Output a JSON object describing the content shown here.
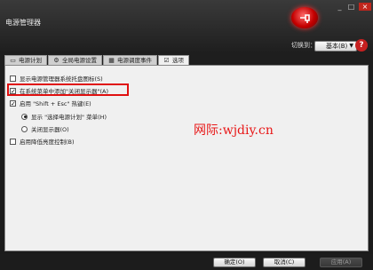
{
  "window": {
    "title": "电源管理器"
  },
  "controls": {
    "minimize": "_",
    "maximize": "□",
    "close": "×"
  },
  "switch": {
    "label": "切换到：",
    "value": "基本(B)"
  },
  "help": {
    "label": "?"
  },
  "tabs": [
    {
      "label": "电源计划",
      "icon": "battery-icon"
    },
    {
      "label": "全局电源设置",
      "icon": "gear-icon"
    },
    {
      "label": "电源调度事件",
      "icon": "calendar-icon"
    },
    {
      "label": "选项",
      "icon": "checkbox-icon"
    }
  ],
  "options": {
    "tray_icon": {
      "label": "显示电源管理器系统托盘图标(S)",
      "checked": false
    },
    "system_menu": {
      "label": "在系统菜单中添加\"关闭显示器\"(A)",
      "checked": true
    },
    "hotkey": {
      "label": "启用 \"Shift + Esc\" 热键(E)",
      "checked": true
    },
    "radio_menu": {
      "label": "显示 \"选择电源计划\" 菜单(H)",
      "selected": true
    },
    "radio_display": {
      "label": "关闭显示器(O)",
      "selected": false
    },
    "brightness": {
      "label": "启用降低亮度控制(B)",
      "checked": false
    }
  },
  "watermark": "网际:wjdiy.cn",
  "buttons": {
    "ok": "确定(O)",
    "cancel": "取消(C)",
    "apply": "应用(A)"
  },
  "colors": {
    "highlight": "#e01010",
    "accent": "#c40000"
  }
}
